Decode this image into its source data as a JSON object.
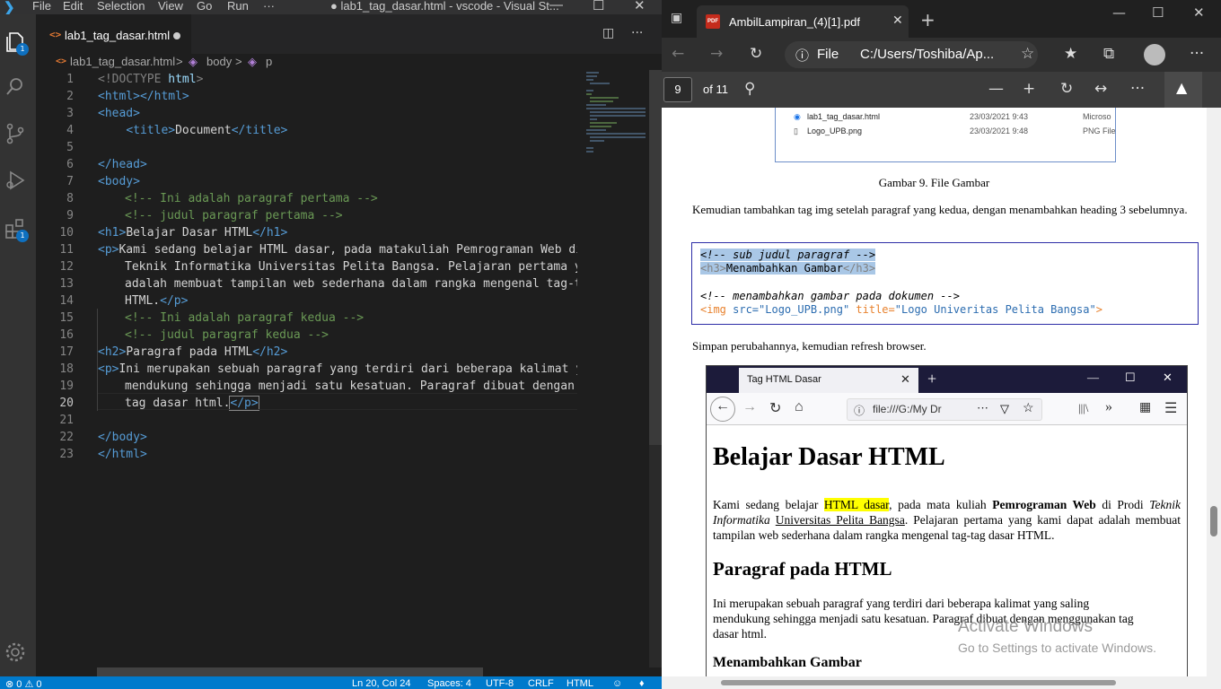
{
  "vscode": {
    "menu": [
      "File",
      "Edit",
      "Selection",
      "View",
      "Go",
      "Run",
      "···"
    ],
    "window_title": "● lab1_tag_dasar.html - vscode - Visual St...",
    "tab_label": "lab1_tag_dasar.html",
    "tab_icon": "<>",
    "breadcrumb": [
      "lab1_tag_dasar.html",
      ">",
      "body",
      ">",
      "p"
    ],
    "activity_badges": [
      "1",
      "1"
    ],
    "line_numbers": [
      "1",
      "2",
      "3",
      "4",
      "5",
      "6",
      "7",
      "8",
      "9",
      "10",
      "11",
      "12",
      "13",
      "14",
      "15",
      "16",
      "17",
      "18",
      "19",
      "20",
      "21",
      "22",
      "23"
    ],
    "code": {
      "l1_a": "<!DOCTYPE",
      "l1_b": " html",
      "l1_c": ">",
      "l2": "<html></html>",
      "l3": "<head>",
      "l4_a": "<title>",
      "l4_b": "Document",
      "l4_c": "</title>",
      "l6": "</head>",
      "l7": "<body>",
      "l8": "<!-- Ini adalah paragraf pertama -->",
      "l9": "<!-- judul paragraf pertama -->",
      "l10_a": "<h1>",
      "l10_b": "Belajar Dasar HTML",
      "l10_c": "</h1>",
      "l11_a": "<p>",
      "l11_b": "Kami sedang belajar HTML dasar, pada matakuliah Pemrograman Web di",
      "l12": "Teknik Informatika Universitas Pelita Bangsa. Pelajaran pertama ya",
      "l13": "adalah membuat tampilan web sederhana dalam rangka mengenal tag-ta",
      "l14_a": "HTML.",
      "l14_b": "</p>",
      "l15": "<!-- Ini adalah paragraf kedua -->",
      "l16": "<!-- judul paragraf kedua -->",
      "l17_a": "<h2>",
      "l17_b": "Paragraf pada HTML",
      "l17_c": "</h2>",
      "l18_a": "<p>",
      "l18_b": "Ini merupakan sebuah paragraf yang terdiri dari beberapa kalimat ya",
      "l19": "mendukung sehingga menjadi satu kesatuan. Paragraf dibuat dengan m",
      "l20_a": "tag dasar html.",
      "l20_b": "</p>",
      "l22": "</body>",
      "l23": "</html>"
    },
    "status": {
      "left": "⊗ 0 ⚠ 0",
      "position": "Ln 20, Col 24",
      "spaces": "Spaces: 4",
      "encoding": "UTF-8",
      "eol": "CRLF",
      "language": "HTML"
    }
  },
  "edge": {
    "tab_title": "AmbilLampiran_(4)[1].pdf",
    "tab_pdf_label": "PDF",
    "address_scheme": "File",
    "address_url": "C:/Users/Toshiba/Ap...",
    "page_number": "9",
    "page_total": "of 11",
    "document": {
      "file_rows": [
        {
          "name": "lab1_tag_dasar.html",
          "date": "23/03/2021 9:43",
          "type": "Microso"
        },
        {
          "name": "Logo_UPB.png",
          "date": "23/03/2021 9:48",
          "type": "PNG File"
        }
      ],
      "caption": "Gambar 9. File Gambar",
      "para1": "Kemudian tambahkan tag img setelah paragraf yang kedua, dengan menambahkan heading 3 sebelumnya.",
      "code": {
        "c1": "<!-- sub judul paragraf -->",
        "c2_a": "<h3>",
        "c2_b": "Menambahkan Gambar",
        "c2_c": "</h3>",
        "c3": "<!-- menambahkan gambar pada dokumen -->",
        "c4_a": "<img",
        "c4_b": " src=",
        "c4_c": "\"Logo_UPB.png\"",
        "c4_d": " title=",
        "c4_e": "\"Logo Univeritas Pelita Bangsa\"",
        "c4_f": ">"
      },
      "para2": "Simpan perubahannya, kemudian refresh browser.",
      "browser": {
        "tab_title": "Tag HTML Dasar",
        "url": "file:///G:/My Dr",
        "h1": "Belajar Dasar HTML",
        "p1_a": "Kami sedang belajar ",
        "p1_hl": "HTML dasar",
        "p1_b": ", pada mata kuliah ",
        "p1_bold": "Pemrograman Web",
        "p1_c": " di Prodi ",
        "p1_it": "Teknik Informatika",
        "p1_d": " ",
        "p1_u": "Universitas Pelita Bangsa",
        "p1_e": ". Pelajaran pertama yang kami dapat adalah membuat tampilan web sederhana dalam rangka mengenal tag-tag dasar HTML.",
        "h2": "Paragraf pada HTML",
        "p2": "Ini merupakan sebuah paragraf yang terdiri dari beberapa kalimat yang saling mendukung sehingga menjadi satu kesatuan. Paragraf dibuat dengan menggunakan tag dasar html.",
        "h3": "Menambahkan Gambar"
      }
    },
    "watermark_title": "Activate Windows",
    "watermark_sub": "Go to Settings to activate Windows."
  }
}
